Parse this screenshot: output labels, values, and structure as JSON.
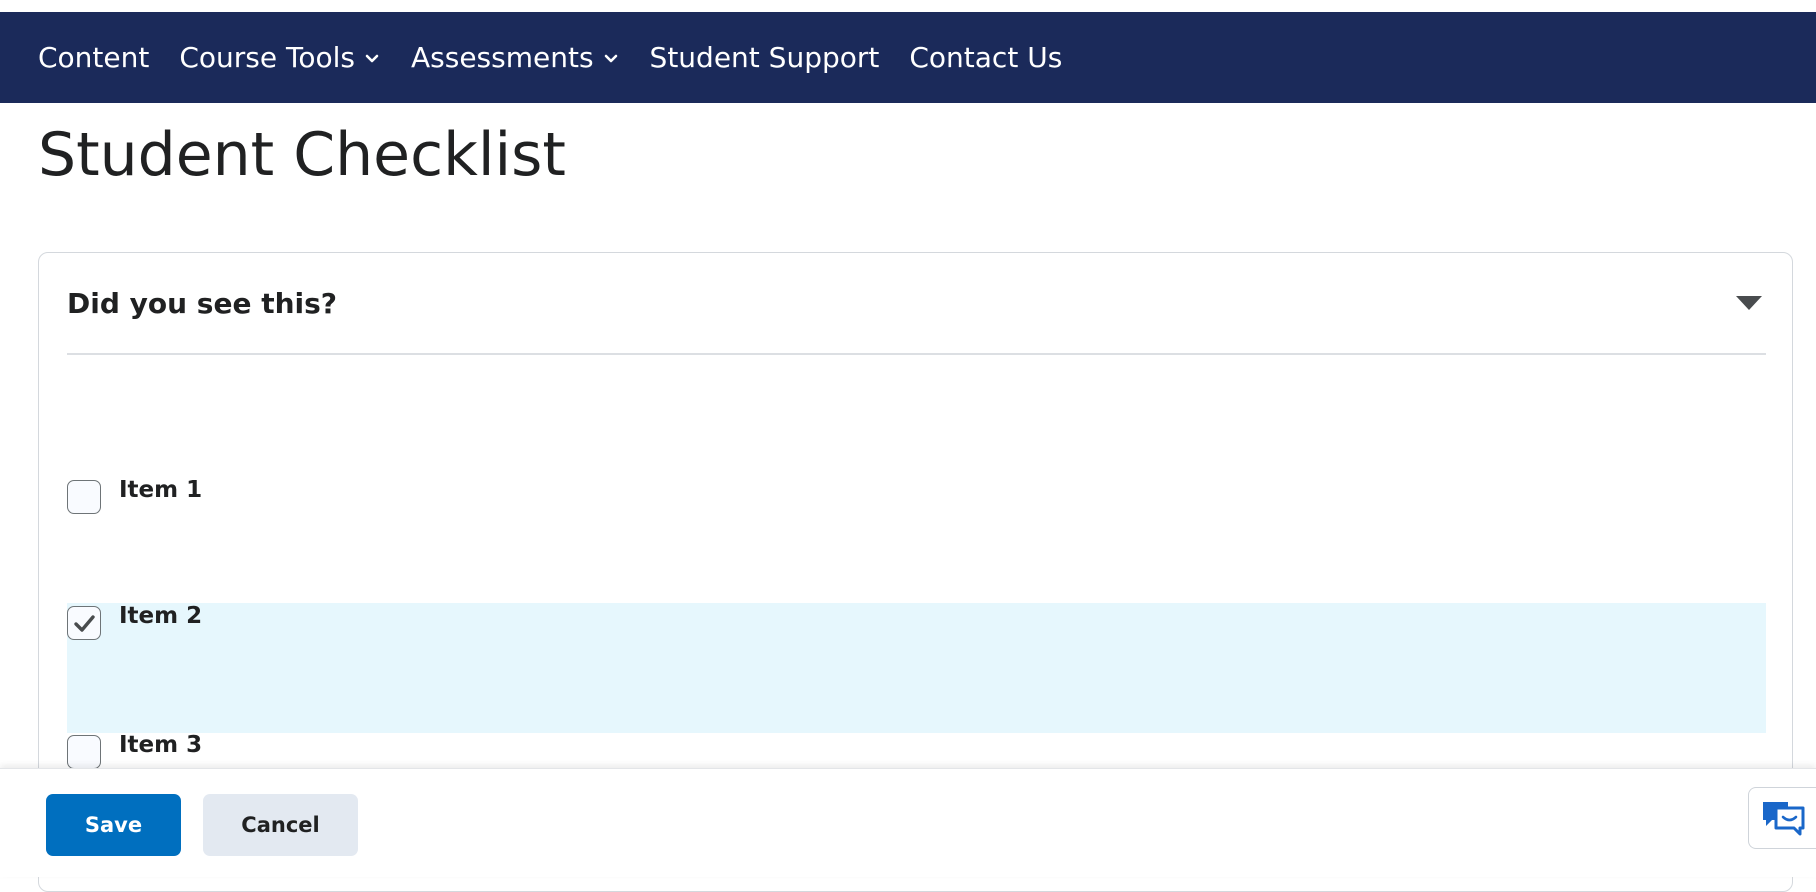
{
  "nav": {
    "items": [
      {
        "label": "Content",
        "has_dropdown": false
      },
      {
        "label": "Course Tools",
        "has_dropdown": true
      },
      {
        "label": "Assessments",
        "has_dropdown": true
      },
      {
        "label": "Student Support",
        "has_dropdown": false
      },
      {
        "label": "Contact Us",
        "has_dropdown": false
      }
    ]
  },
  "page": {
    "title": "Student Checklist"
  },
  "checklist": {
    "category_title": "Did you see this?",
    "items": [
      {
        "label": "Item 1",
        "checked": false
      },
      {
        "label": "Item 2",
        "checked": true
      },
      {
        "label": "Item 3",
        "checked": false
      }
    ]
  },
  "footer": {
    "save_label": "Save",
    "cancel_label": "Cancel"
  },
  "colors": {
    "navbar_bg": "#1b2a5a",
    "primary_button": "#006fbf",
    "selected_row": "#e6f7fd"
  },
  "icons": [
    "chevron-down-icon",
    "caret-down-icon",
    "checkmark-icon",
    "chat-icon"
  ]
}
